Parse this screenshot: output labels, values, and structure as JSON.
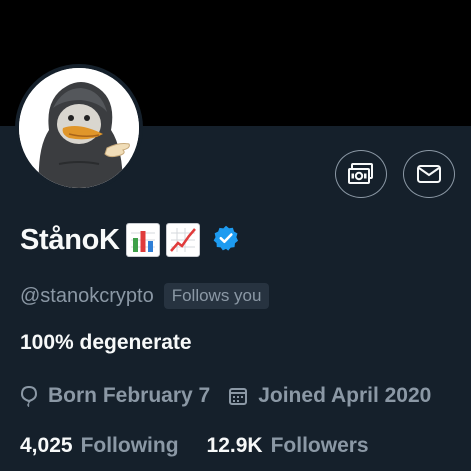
{
  "profile": {
    "display_name": "StånoK",
    "handle": "@stanokcrypto",
    "follows_you_badge": "Follows you",
    "bio": "100% degenerate",
    "born": "Born February 7",
    "joined": "Joined April 2020",
    "following_count": "4,025",
    "following_label": "Following",
    "followers_count": "12.9K",
    "followers_label": "Followers",
    "name_emojis": [
      "bar-chart-emoji",
      "chart-increasing-emoji"
    ]
  },
  "icons": {
    "tip": "money-icon",
    "message": "envelope-icon",
    "verified": "verified-badge-icon",
    "birthday": "balloon-icon",
    "joined": "calendar-icon"
  },
  "colors": {
    "background": "#15202b",
    "banner": "#000000",
    "primary_text": "#f7f9f9",
    "secondary_text": "#8b98a5",
    "verified_blue": "#1d9bf0",
    "badge_bg": "#273340"
  }
}
